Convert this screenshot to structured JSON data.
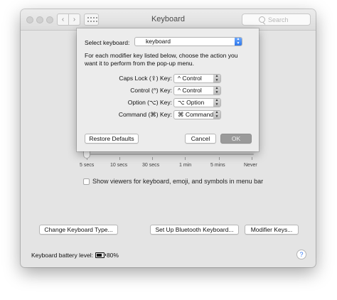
{
  "window": {
    "title": "Keyboard",
    "search_placeholder": "Search"
  },
  "sheet": {
    "select_label": "Select keyboard:",
    "selected_keyboard": "keyboard",
    "description_line1": "For each modifier key listed below, choose the action you",
    "description_line2": "want it to perform from the pop-up menu.",
    "rows": [
      {
        "label": "Caps Lock (⇪) Key:",
        "value": "^ Control"
      },
      {
        "label": "Control (^) Key:",
        "value": "^ Control"
      },
      {
        "label": "Option (⌥) Key:",
        "value": "⌥ Option"
      },
      {
        "label": "Command (⌘) Key:",
        "value": "⌘ Command"
      }
    ],
    "restore_label": "Restore Defaults",
    "cancel_label": "Cancel",
    "ok_label": "OK"
  },
  "slider": {
    "ticks": [
      "5 secs",
      "10 secs",
      "30 secs",
      "1 min",
      "5 mins",
      "Never"
    ],
    "value": "5 secs"
  },
  "show_viewers": {
    "label": "Show viewers for keyboard, emoji, and symbols in menu bar",
    "checked": false
  },
  "buttons": {
    "change_type": "Change Keyboard Type...",
    "bluetooth": "Set Up Bluetooth Keyboard...",
    "modifier": "Modifier Keys..."
  },
  "battery": {
    "label": "Keyboard battery level:",
    "value": "80%"
  },
  "colors": {
    "accent": "#2f78ea",
    "ok_disabled": "#9a9a9a"
  }
}
